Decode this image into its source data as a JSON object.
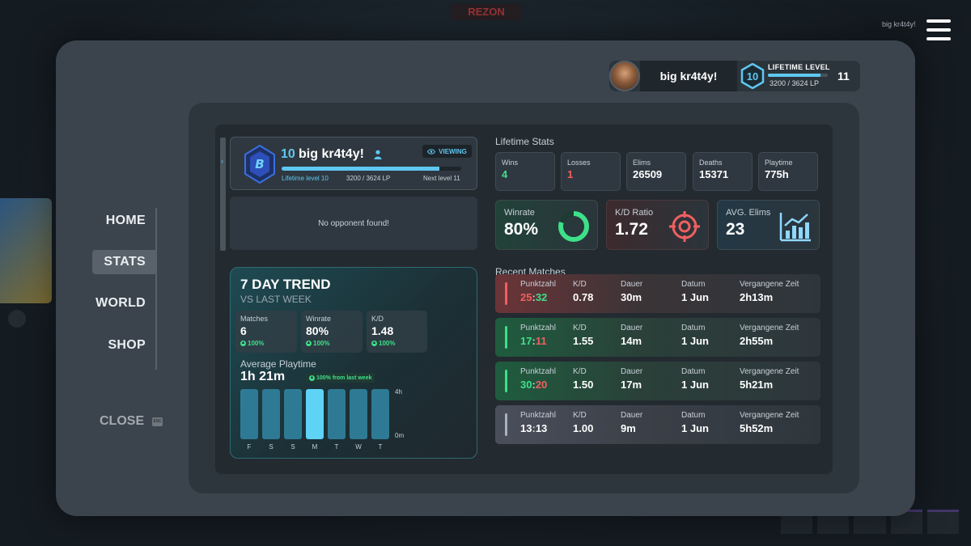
{
  "background": {
    "logo_text": "REZON",
    "topright_name": "big kr4t4y!"
  },
  "header": {
    "player_name": "big kr4t4y!",
    "level": "10",
    "lifetime_label": "LIFETIME LEVEL",
    "lifetime_progress": 0.88,
    "lifetime_lp": "3200 / 3624 LP",
    "next_level": "11"
  },
  "nav": {
    "items": [
      {
        "label": "HOME",
        "active": false
      },
      {
        "label": "STATS",
        "active": true
      },
      {
        "label": "WORLD",
        "active": false
      },
      {
        "label": "SHOP",
        "active": false
      }
    ],
    "close_label": "CLOSE",
    "close_key": "ESC"
  },
  "profile_card": {
    "level": "10",
    "name": "big kr4t4y!",
    "viewing_label": "VIEWING",
    "progress": 0.88,
    "level_text": "Lifetime level 10",
    "lp_text": "3200 / 3624 LP",
    "next_text": "Next level 11",
    "opponent_text": "No opponent found!"
  },
  "trend": {
    "title": "7 DAY TREND",
    "subtitle": "VS LAST WEEK",
    "cards": [
      {
        "label": "Matches",
        "value": "6",
        "delta": "100%"
      },
      {
        "label": "Winrate",
        "value": "80%",
        "delta": "100%"
      },
      {
        "label": "K/D",
        "value": "1.48",
        "delta": "100%"
      }
    ],
    "avg_label": "Average Playtime",
    "avg_value": "1h 21m",
    "avg_delta": "100% from last week",
    "y_max_label": "4h",
    "y_min_label": "0m"
  },
  "chart_data": {
    "type": "bar",
    "categories": [
      "F",
      "S",
      "S",
      "M",
      "T",
      "W",
      "T"
    ],
    "values": [
      4,
      4,
      4,
      4,
      4,
      4,
      4
    ],
    "highlight_index": 3,
    "ylim": [
      0,
      4
    ],
    "y_ticks": [
      "4h",
      "0m"
    ],
    "colors": {
      "bar": "#2e7a94",
      "highlight": "#5ed3f5"
    }
  },
  "lifetime_stats": {
    "title": "Lifetime Stats",
    "boxes": [
      {
        "label": "Wins",
        "value": "4",
        "color": "#3ee08a"
      },
      {
        "label": "Losses",
        "value": "1",
        "color": "#f06060"
      },
      {
        "label": "Elims",
        "value": "26509",
        "color": "#ffffff"
      },
      {
        "label": "Deaths",
        "value": "15371",
        "color": "#ffffff"
      },
      {
        "label": "Playtime",
        "value": "775h",
        "color": "#ffffff"
      }
    ],
    "winrate_label": "Winrate",
    "winrate_value": "80%",
    "winrate_fraction": 0.8,
    "kd_label": "K/D Ratio",
    "kd_value": "1.72",
    "elims_label": "AVG. Elims",
    "elims_value": "23"
  },
  "recent_matches": {
    "title": "Recent Matches",
    "headers": {
      "score": "Punktzahl",
      "kd": "K/D",
      "duration": "Dauer",
      "date": "Datum",
      "elapsed": "Vergangene Zeit"
    },
    "rows": [
      {
        "result": "loss",
        "score_a": "25",
        "score_b": "32",
        "kd": "0.78",
        "duration": "30m",
        "date": "1 Jun",
        "elapsed": "2h13m"
      },
      {
        "result": "win",
        "score_a": "17",
        "score_b": "11",
        "kd": "1.55",
        "duration": "14m",
        "date": "1 Jun",
        "elapsed": "2h55m"
      },
      {
        "result": "win",
        "score_a": "30",
        "score_b": "20",
        "kd": "1.50",
        "duration": "17m",
        "date": "1 Jun",
        "elapsed": "5h21m"
      },
      {
        "result": "draw",
        "score_a": "13",
        "score_b": "13",
        "kd": "1.00",
        "duration": "9m",
        "date": "1 Jun",
        "elapsed": "5h52m"
      }
    ]
  },
  "colors": {
    "accent": "#5ec8f2",
    "win": "#3ee08a",
    "loss": "#f06060"
  }
}
